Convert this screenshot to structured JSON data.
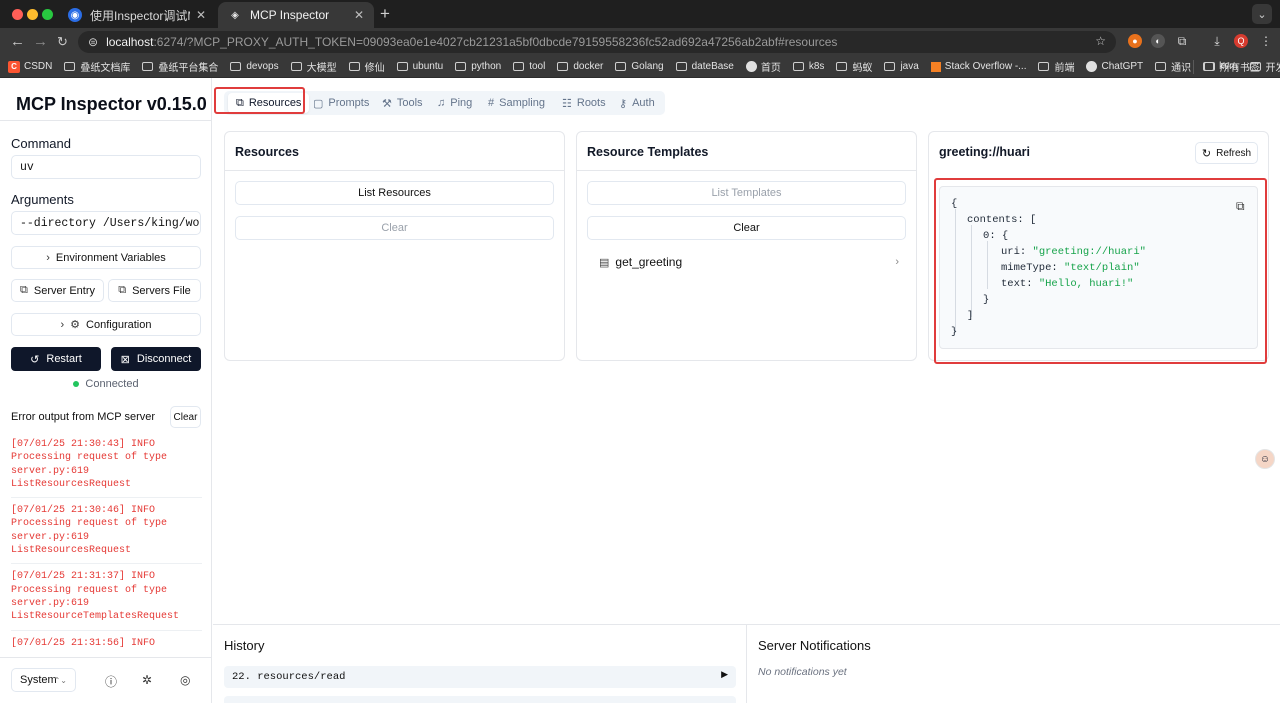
{
  "browser": {
    "tabs": [
      {
        "title": "使用Inspector调试MCP服务 -"
      },
      {
        "title": "MCP Inspector"
      }
    ],
    "url": {
      "host": "localhost",
      "rest": ":6274/?MCP_PROXY_AUTH_TOKEN=09093ea0e1e4027cb21231a5bf0dbcde79159558236fc52ad692a47256ab2abf#resources"
    },
    "profile_initial": "Q",
    "bookmarks": [
      "CSDN",
      "叠纸文档库",
      "叠纸平台集合",
      "devops",
      "大模型",
      "修仙",
      "ubuntu",
      "python",
      "tool",
      "docker",
      "Golang",
      "dateBase",
      "首页",
      "k8s",
      "蚂蚁",
      "java",
      "Stack Overflow -...",
      "前端",
      "ChatGPT",
      "通识",
      "kvm",
      "开发"
    ],
    "all_bookmarks": "所有书签"
  },
  "sidebar": {
    "title": "MCP Inspector v0.15.0",
    "command_label": "Command",
    "command_value": "uv",
    "arguments_label": "Arguments",
    "arguments_value": "--directory /Users/king/workspa",
    "env_vars": "Environment Variables",
    "server_entry": "Server Entry",
    "servers_file": "Servers File",
    "configuration": "Configuration",
    "restart": "Restart",
    "disconnect": "Disconnect",
    "status": "Connected",
    "error_title": "Error output from MCP server",
    "clear": "Clear",
    "logs": [
      "[07/01/25 21:30:43] INFO\nProcessing request of type\nserver.py:619\nListResourcesRequest",
      "[07/01/25 21:30:46] INFO\nProcessing request of type\nserver.py:619\nListResourcesRequest",
      "[07/01/25 21:31:37] INFO\nProcessing request of type\nserver.py:619\nListResourceTemplatesRequest",
      "[07/01/25 21:31:56] INFO"
    ],
    "theme": "System"
  },
  "main": {
    "tabs": [
      "Resources",
      "Prompts",
      "Tools",
      "Ping",
      "Sampling",
      "Roots",
      "Auth"
    ],
    "resources": {
      "title": "Resources",
      "list_btn": "List Resources",
      "clear_btn": "Clear"
    },
    "templates": {
      "title": "Resource Templates",
      "list_btn": "List Templates",
      "clear_btn": "Clear",
      "items": [
        "get_greeting"
      ]
    },
    "detail": {
      "title": "greeting://huari",
      "refresh": "Refresh",
      "json": {
        "contents_key": "contents",
        "index_key": "0",
        "uri": "\"greeting://huari\"",
        "mimeType": "\"text/plain\"",
        "text": "\"Hello, huari!\""
      }
    },
    "history": {
      "title": "History",
      "items": [
        "22. resources/read"
      ]
    },
    "notifications": {
      "title": "Server Notifications",
      "empty": "No notifications yet"
    }
  },
  "colors": {
    "accent": "#0f172a",
    "highlight": "#e03c3c",
    "error": "#e53935",
    "connected": "#22c55e",
    "json_string": "#16a34a"
  }
}
